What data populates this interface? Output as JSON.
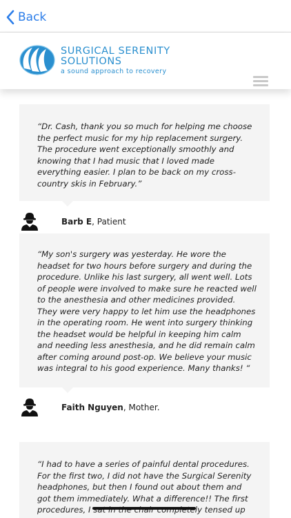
{
  "nav": {
    "back_label": "Back"
  },
  "brand": {
    "title_line1": "SURGICAL SERENITY",
    "title_line2": "SOLUTIONS",
    "tagline": "a sound approach to recovery"
  },
  "testimonials": [
    {
      "quote": "“Dr. Cash, thank you so much for helping me choose\nthe perfect music for my hip replacement surgery.\nThe procedure went exceptionally smoothly and\nknowing that I had music that I loved made\neverything easier.  I plan to be back on my cross-\ncountry skis in February.”",
      "name": "Barb E",
      "role": ", Patient"
    },
    {
      "quote": "“My son's surgery was yesterday.  He wore the\nheadset for two hours before surgery and during the\nprocedure.  Unlike his last surgery, all went well.  Lots\nof people were involved to make sure he reacted well\nto the anesthesia and other medicines provided.\n They were very happy to let him use the headphones\nin the operating room.  He went into surgery thinking\nthe headset would be helpful in keeping him calm\nand needing less anesthesia, and he did remain calm\nafter coming around post-op.  We believe your music\nwas integral to his good experience.  Many thanks! “",
      "name": "Faith Nguyen",
      "role": ", Mother."
    },
    {
      "quote": "“I had to have a series of painful dental procedures.\n For the first two, I did not have the Surgical Serenity\nheadphones, but then I found out about them and\ngot them immediately.  What a difference!!  The first\nprocedures, I sat in the chair completely tensed up"
    }
  ],
  "colors": {
    "accent": "#2b7de9",
    "brand": "#2a8fcf",
    "card_bg": "#f4f4f4"
  }
}
